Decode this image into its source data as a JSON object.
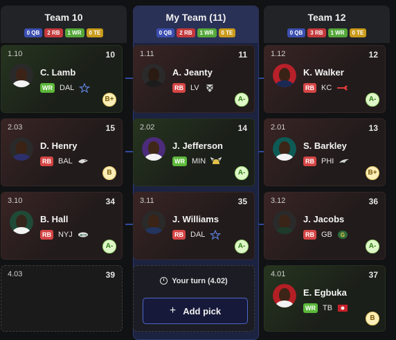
{
  "columns": [
    {
      "team": "Team 10",
      "mine": false,
      "counts": {
        "qb": "0 QB",
        "rb": "2 RB",
        "wr": "1 WR",
        "te": "0 TE"
      },
      "picks": [
        {
          "pick": "1.10",
          "rank": "10",
          "name": "C. Lamb",
          "pos": "WR",
          "team": "DAL",
          "grade": "B+",
          "grade_level": "B",
          "logo": "star-icon",
          "face": "#3b2417"
        },
        {
          "pick": "2.03",
          "rank": "15",
          "name": "D. Henry",
          "pos": "RB",
          "team": "BAL",
          "grade": "B",
          "grade_level": "B",
          "logo": "raven-icon",
          "face": "#3a2214"
        },
        {
          "pick": "3.10",
          "rank": "34",
          "name": "B. Hall",
          "pos": "RB",
          "team": "NYJ",
          "grade": "A-",
          "grade_level": "A",
          "logo": "jets-icon",
          "face": "#34261a"
        },
        {
          "pick": "4.03",
          "rank": "39",
          "empty": true
        }
      ]
    },
    {
      "team": "My Team (11)",
      "mine": true,
      "counts": {
        "qb": "0 QB",
        "rb": "2 RB",
        "wr": "1 WR",
        "te": "0 TE"
      },
      "picks": [
        {
          "pick": "1.11",
          "rank": "11",
          "name": "A. Jeanty",
          "pos": "RB",
          "team": "LV",
          "grade": "A-",
          "grade_level": "A",
          "logo": "raiders-icon",
          "face": "#2a1a12"
        },
        {
          "pick": "2.02",
          "rank": "14",
          "name": "J. Jefferson",
          "pos": "WR",
          "team": "MIN",
          "grade": "A-",
          "grade_level": "A",
          "logo": "viking-icon",
          "face": "#3f2818"
        },
        {
          "pick": "3.11",
          "rank": "35",
          "name": "J. Williams",
          "pos": "RB",
          "team": "DAL",
          "grade": "A-",
          "grade_level": "A",
          "logo": "star-icon",
          "face": "#3b2315"
        }
      ],
      "current": {
        "your_turn": "Your turn (4.02)",
        "add_pick": "Add pick"
      }
    },
    {
      "team": "Team 12",
      "mine": false,
      "counts": {
        "qb": "0 QB",
        "rb": "3 RB",
        "wr": "1 WR",
        "te": "0 TE"
      },
      "picks": [
        {
          "pick": "1.12",
          "rank": "12",
          "name": "K. Walker",
          "pos": "RB",
          "team": "KC",
          "grade": "A-",
          "grade_level": "A",
          "logo": "chiefs-icon",
          "face": "#3a2316"
        },
        {
          "pick": "2.01",
          "rank": "13",
          "name": "S. Barkley",
          "pos": "RB",
          "team": "PHI",
          "grade": "B+",
          "grade_level": "B",
          "logo": "eagle-icon",
          "face": "#3c2416"
        },
        {
          "pick": "3.12",
          "rank": "36",
          "name": "J. Jacobs",
          "pos": "RB",
          "team": "GB",
          "grade": "A-",
          "grade_level": "A",
          "logo": "packers-icon",
          "face": "#3a2417"
        },
        {
          "pick": "4.01",
          "rank": "37",
          "name": "E. Egbuka",
          "pos": "WR",
          "team": "TB",
          "grade": "B",
          "grade_level": "B",
          "logo": "bucs-flag-icon",
          "face": "#3c2416"
        }
      ]
    }
  ],
  "colors": {
    "rb": "#d64545",
    "wr": "#5cb83a",
    "qb": "#3c4fb0",
    "te": "#c99a1c",
    "accent": "#4f67c9"
  }
}
